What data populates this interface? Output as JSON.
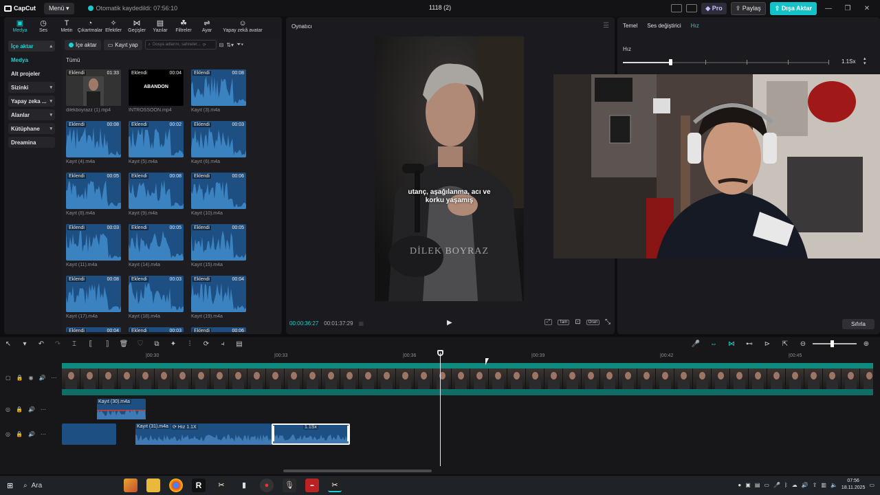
{
  "titlebar": {
    "app_name": "CapCut",
    "menu_label": "Menü",
    "autosave": "Otomatik kaydedildi: 07:56:10",
    "project_title": "1118 (2)",
    "pro_label": "Pro",
    "share_label": "Paylaş",
    "export_label": "Dışa Aktar"
  },
  "toolbar": {
    "items": [
      "Medya",
      "Ses",
      "Metin",
      "Çıkartmalar",
      "Efektler",
      "Geçişler",
      "Yazılar",
      "Filtreler",
      "Ayar",
      "Yapay zekâ avatar"
    ],
    "icons": [
      "media-icon",
      "audio-icon",
      "text-icon",
      "sticker-icon",
      "effects-icon",
      "transitions-icon",
      "captions-icon",
      "filters-icon",
      "adjust-icon",
      "ai-avatar-icon"
    ]
  },
  "leftnav": {
    "items": [
      "İçe aktar",
      "Medya",
      "Alt projeler",
      "Sizinki",
      "Yapay zeka ...",
      "Alanlar",
      "Kütüphane",
      "Dreamina"
    ]
  },
  "media": {
    "import_label": "İçe aktar",
    "record_label": "Kayıt yap",
    "search_placeholder": "Dosya adlarını, sahneler...",
    "all_label": "Tümü",
    "added_label": "Eklendi",
    "items": [
      {
        "name": "dilekboyrazz (1).mp4",
        "dur": "01:33",
        "kind": "video"
      },
      {
        "name": "INTROSSOON.mp4",
        "dur": "00:04",
        "kind": "intro",
        "overlay": "ABANDON"
      },
      {
        "name": "Kayıt (3).m4a",
        "dur": "00:08",
        "kind": "audio"
      },
      {
        "name": "Kayıt (4).m4a",
        "dur": "00:08",
        "kind": "audio"
      },
      {
        "name": "Kayıt (5).m4a",
        "dur": "00:02",
        "kind": "audio"
      },
      {
        "name": "Kayıt (6).m4a",
        "dur": "00:03",
        "kind": "audio"
      },
      {
        "name": "Kayıt (8).m4a",
        "dur": "00:05",
        "kind": "audio"
      },
      {
        "name": "Kayıt (9).m4a",
        "dur": "00:08",
        "kind": "audio"
      },
      {
        "name": "Kayıt (10).m4a",
        "dur": "00:06",
        "kind": "audio"
      },
      {
        "name": "Kayıt (11).m4a",
        "dur": "00:03",
        "kind": "audio"
      },
      {
        "name": "Kayıt (14).m4a",
        "dur": "00:05",
        "kind": "audio"
      },
      {
        "name": "Kayıt (15).m4a",
        "dur": "00:05",
        "kind": "audio"
      },
      {
        "name": "Kayıt (17).m4a",
        "dur": "00:08",
        "kind": "audio"
      },
      {
        "name": "Kayıt (18).m4a",
        "dur": "00:03",
        "kind": "audio"
      },
      {
        "name": "Kayıt (19).m4a",
        "dur": "00:04",
        "kind": "audio"
      },
      {
        "name": "",
        "dur": "00:04",
        "kind": "audio"
      },
      {
        "name": "",
        "dur": "00:03",
        "kind": "audio"
      },
      {
        "name": "",
        "dur": "00:06",
        "kind": "audio"
      }
    ]
  },
  "player": {
    "title": "Oynatıcı",
    "subtitle_line1": "utanç, aşağılanma, acı ve",
    "subtitle_line2": "korku yaşamış",
    "watermark": "DİLEK BOYRAZ",
    "current_time": "00:00:36:27",
    "total_time": "00:01:37:29",
    "full_label": "Tam",
    "ratio_label": "Oran"
  },
  "props": {
    "tabs": [
      "Temel",
      "Ses değiştirici",
      "Hız"
    ],
    "active_tab": "Hız",
    "speed_label": "Hız",
    "speed_value": "1.1Sx",
    "speed_fraction": 0.23,
    "reset_label": "Sıfırla"
  },
  "timeline": {
    "ruler": [
      "00:30",
      "00:33",
      "00:36",
      "00:39",
      "00:42",
      "00:45"
    ],
    "clips": {
      "audio1": "Kayıt (30).m4a",
      "audio2": "Kayıt (31).m4a",
      "speed_tag": "Hız 1.1X",
      "selected_tag": "1.1Sx"
    }
  },
  "taskbar": {
    "search_label": "Ara",
    "time": "07:56",
    "date": "18.11.2025"
  },
  "colors": {
    "accent": "#19d3d3",
    "export": "#14c1c8",
    "audio_clip": "#1e4f82",
    "video_track": "#0f8a7e"
  }
}
